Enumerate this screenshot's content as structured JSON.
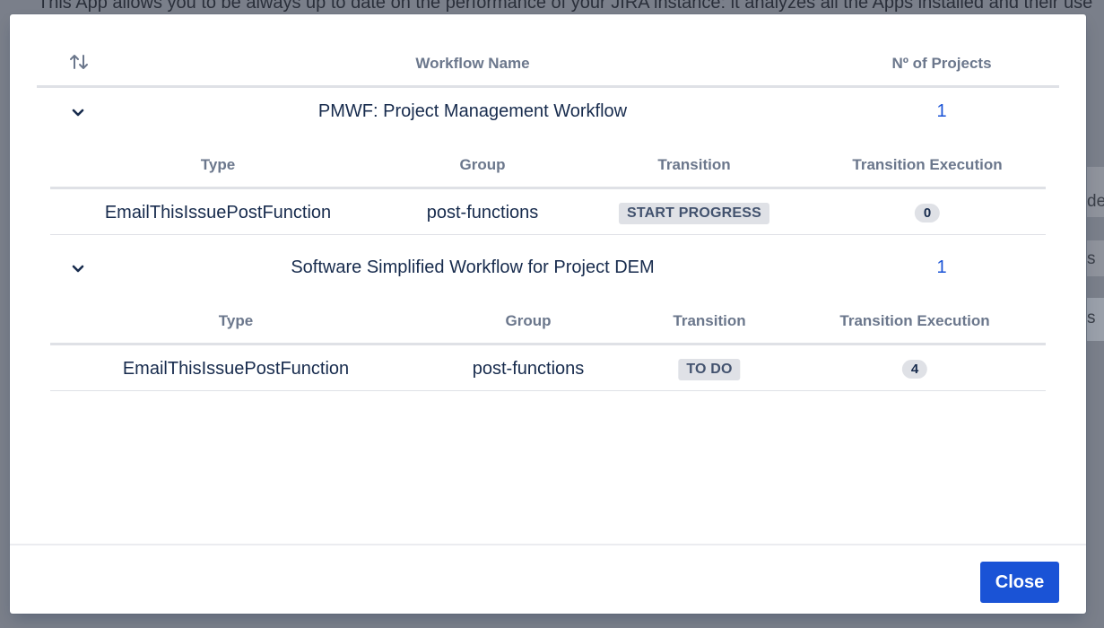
{
  "background": {
    "intro_text": "This App allows you to be always up to date on the performance of your JIRA instance: it analyzes all the Apps installed and their use",
    "side_fragments": [
      "det",
      "s",
      "s"
    ]
  },
  "table": {
    "sort_icon": "sort-arrows-icon",
    "col_workflow_name": "Workflow Name",
    "col_num_projects": "Nº of Projects"
  },
  "workflows": [
    {
      "name": "PMWF: Project Management Workflow",
      "projects": "1",
      "sub_headers": {
        "type": "Type",
        "group": "Group",
        "transition": "Transition",
        "execution": "Transition Execution"
      },
      "rows": [
        {
          "type": "EmailThisIssuePostFunction",
          "group": "post-functions",
          "transition": "START PROGRESS",
          "execution": "0"
        }
      ]
    },
    {
      "name": "Software Simplified Workflow for Project DEM",
      "projects": "1",
      "sub_headers": {
        "type": "Type",
        "group": "Group",
        "transition": "Transition",
        "execution": "Transition Execution"
      },
      "rows": [
        {
          "type": "EmailThisIssuePostFunction",
          "group": "post-functions",
          "transition": "TO DO",
          "execution": "4"
        }
      ]
    }
  ],
  "footer": {
    "close_label": "Close"
  },
  "colors": {
    "primary": "#1a53d6",
    "overlay": "#7a7f8a",
    "muted_header": "#6b778c",
    "lozenge": "#dfe1e6"
  }
}
